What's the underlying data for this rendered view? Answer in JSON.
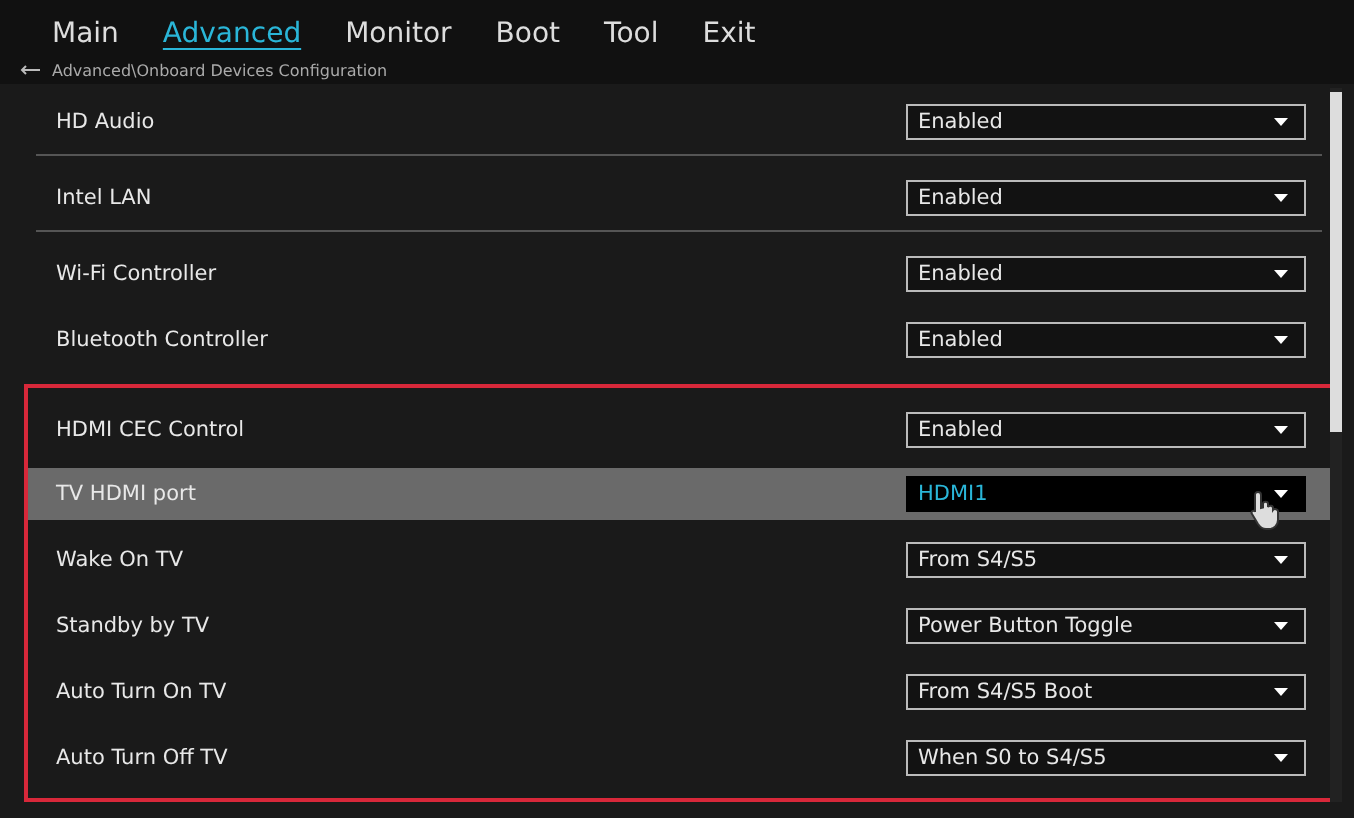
{
  "tabs": [
    {
      "label": "Main",
      "selected": false
    },
    {
      "label": "Advanced",
      "selected": true
    },
    {
      "label": "Monitor",
      "selected": false
    },
    {
      "label": "Boot",
      "selected": false
    },
    {
      "label": "Tool",
      "selected": false
    },
    {
      "label": "Exit",
      "selected": false
    }
  ],
  "breadcrumb": "Advanced\\Onboard Devices Configuration",
  "groups": [
    {
      "framed": false,
      "rows": [
        {
          "label": "HD Audio",
          "value": "Enabled",
          "selected": false
        }
      ]
    },
    {
      "framed": false,
      "rows": [
        {
          "label": "Intel LAN",
          "value": "Enabled",
          "selected": false
        }
      ]
    },
    {
      "framed": false,
      "rows": [
        {
          "label": "Wi-Fi Controller",
          "value": "Enabled",
          "selected": false
        },
        {
          "label": "Bluetooth Controller",
          "value": "Enabled",
          "selected": false
        }
      ]
    },
    {
      "framed": true,
      "rows": [
        {
          "label": "HDMI CEC Control",
          "value": "Enabled",
          "selected": false
        },
        {
          "label": "TV HDMI port",
          "value": "HDMI1",
          "selected": true
        },
        {
          "label": "Wake On TV",
          "value": "From S4/S5",
          "selected": false
        },
        {
          "label": "Standby by TV",
          "value": "Power Button Toggle",
          "selected": false
        },
        {
          "label": "Auto Turn On TV",
          "value": "From S4/S5 Boot",
          "selected": false
        },
        {
          "label": "Auto Turn Off TV",
          "value": "When S0 to S4/S5",
          "selected": false
        }
      ]
    }
  ]
}
